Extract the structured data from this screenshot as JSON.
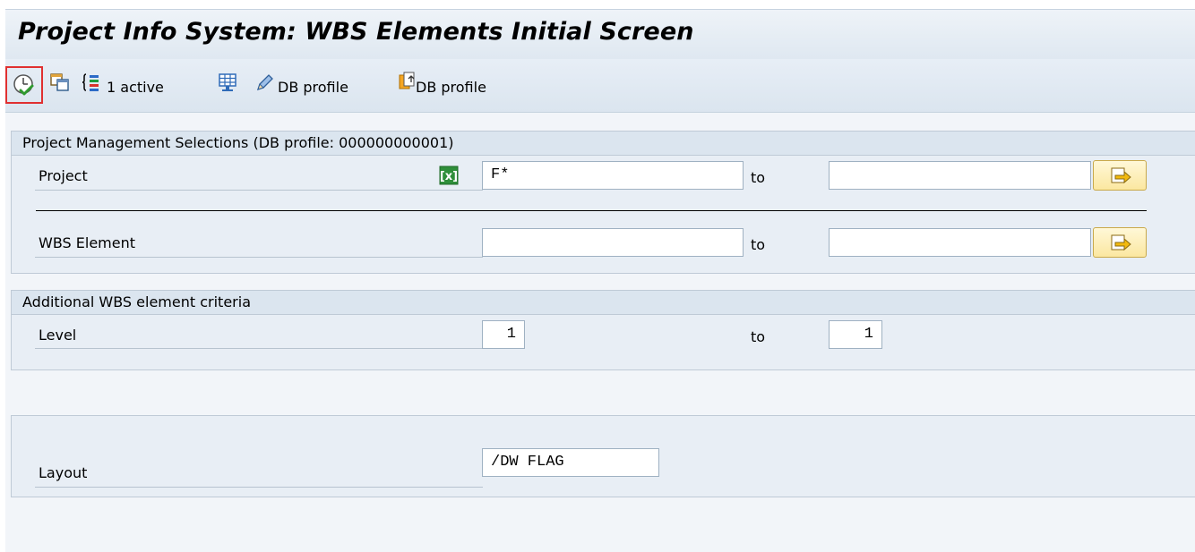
{
  "window": {
    "title": "Project Info System: WBS Elements Initial Screen"
  },
  "toolbar": {
    "execute_icon": "execute-clock-check-icon",
    "selection_screen_icon": "selection-screen-icon",
    "status_count_label": "1  active",
    "db_profile_label_1": "DB profile",
    "db_profile_label_2": "DB profile"
  },
  "sections": {
    "project_management": {
      "title": "Project Management Selections (DB profile: 000000000001)",
      "project": {
        "label": "Project",
        "from_value": "F*",
        "to_label": "to",
        "to_value": ""
      },
      "wbs_element": {
        "label": "WBS Element",
        "from_value": "",
        "to_label": "to",
        "to_value": ""
      }
    },
    "additional_criteria": {
      "title": "Additional WBS element criteria",
      "level": {
        "label": "Level",
        "from_value": "1",
        "to_label": "to",
        "to_value": "1"
      }
    },
    "layout": {
      "label": "Layout",
      "value": "/DW FLAG"
    }
  },
  "colors": {
    "highlight_box": "#e03030",
    "multiple_selection_bg": "#fbe7a0"
  }
}
